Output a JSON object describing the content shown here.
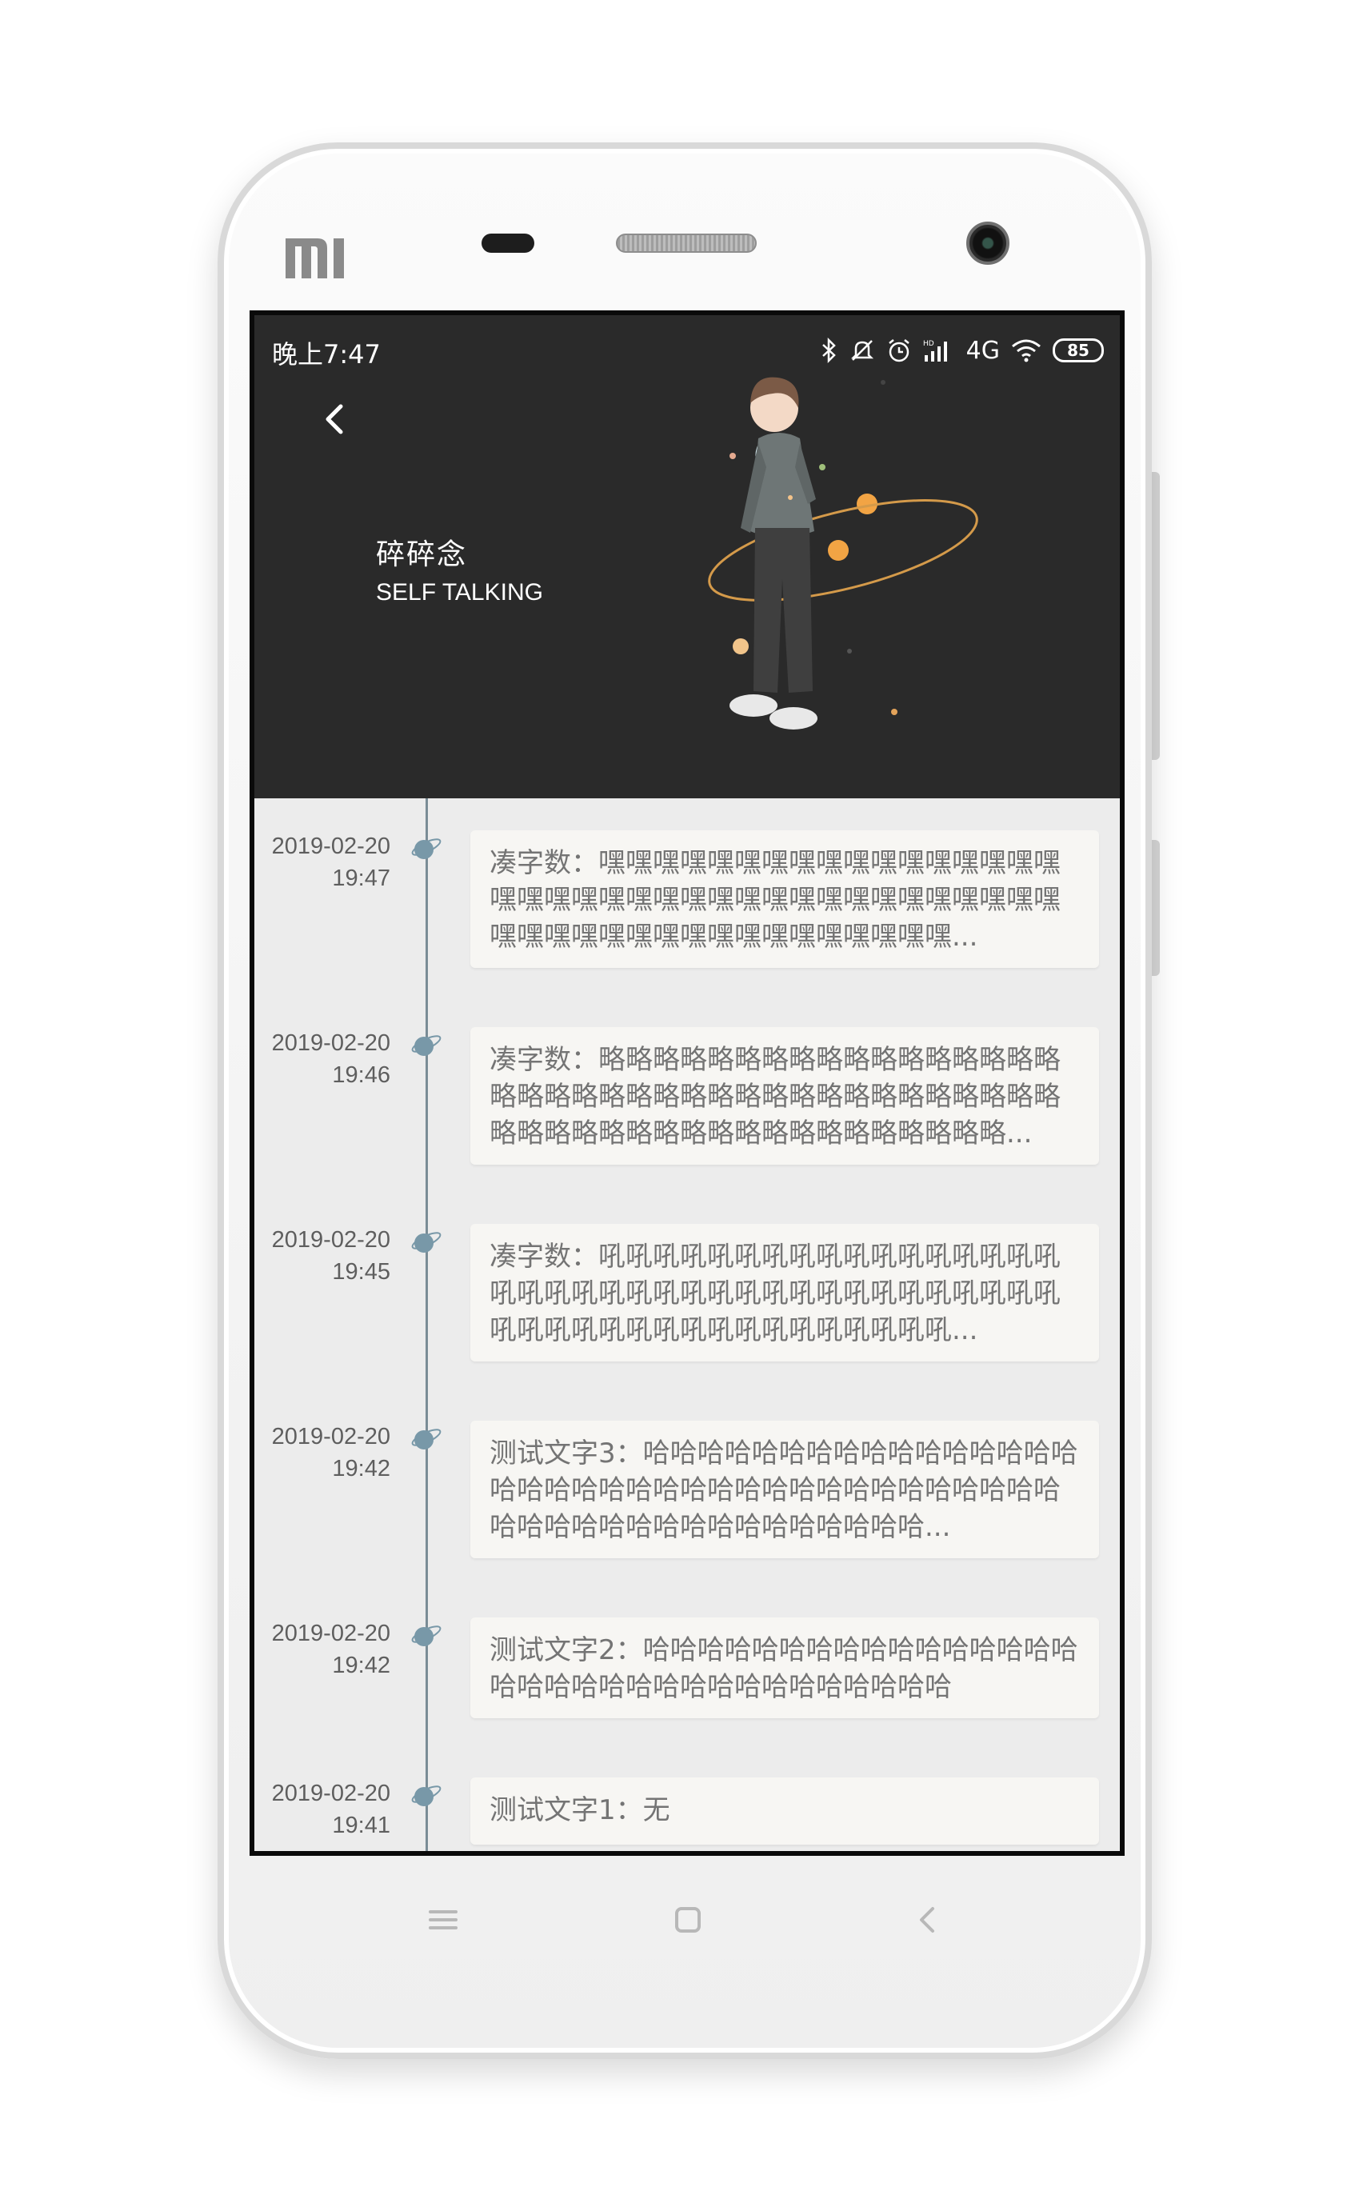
{
  "device": {
    "brand_logo": "mi-logo"
  },
  "status_bar": {
    "time": "晚上7:47",
    "icons": [
      "bluetooth-icon",
      "mute-icon",
      "alarm-icon",
      "signal-icon",
      "4g-icon",
      "wifi-icon"
    ],
    "network": "4G",
    "battery": "85"
  },
  "header": {
    "back_icon": "chevron-left-icon",
    "title": "碎碎念",
    "subtitle": "SELF TALKING",
    "background_color": "#2a2a2a"
  },
  "timeline": {
    "line_color": "#7a8c96",
    "entries": [
      {
        "date": "2019-02-20",
        "time": "19:47",
        "text": "凑字数：嘿嘿嘿嘿嘿嘿嘿嘿嘿嘿嘿嘿嘿嘿嘿嘿嘿嘿嘿嘿嘿嘿嘿嘿嘿嘿嘿嘿嘿嘿嘿嘿嘿嘿嘿嘿嘿嘿嘿嘿嘿嘿嘿嘿嘿嘿嘿嘿嘿嘿嘿嘿嘿嘿嘿..."
      },
      {
        "date": "2019-02-20",
        "time": "19:46",
        "text": "凑字数：略略略略略略略略略略略略略略略略略略略略略略略略略略略略略略略略略略略略略略略略略略略略略略略略略略略略略略略略略..."
      },
      {
        "date": "2019-02-20",
        "time": "19:45",
        "text": "凑字数：吼吼吼吼吼吼吼吼吼吼吼吼吼吼吼吼吼吼吼吼吼吼吼吼吼吼吼吼吼吼吼吼吼吼吼吼吼吼吼吼吼吼吼吼吼吼吼吼吼吼吼吼吼吼吼..."
      },
      {
        "date": "2019-02-20",
        "time": "19:42",
        "text": "测试文字3：哈哈哈哈哈哈哈哈哈哈哈哈哈哈哈哈哈哈哈哈哈哈哈哈哈哈哈哈哈哈哈哈哈哈哈哈哈哈哈哈哈哈哈哈哈哈哈哈哈哈哈哈哈..."
      },
      {
        "date": "2019-02-20",
        "time": "19:42",
        "text": "测试文字2：哈哈哈哈哈哈哈哈哈哈哈哈哈哈哈哈哈哈哈哈哈哈哈哈哈哈哈哈哈哈哈哈哈"
      },
      {
        "date": "2019-02-20",
        "time": "19:41",
        "text": "测试文字1：无"
      }
    ]
  },
  "nav_bar": {
    "icons": [
      "menu-icon",
      "home-icon",
      "back-icon"
    ]
  }
}
